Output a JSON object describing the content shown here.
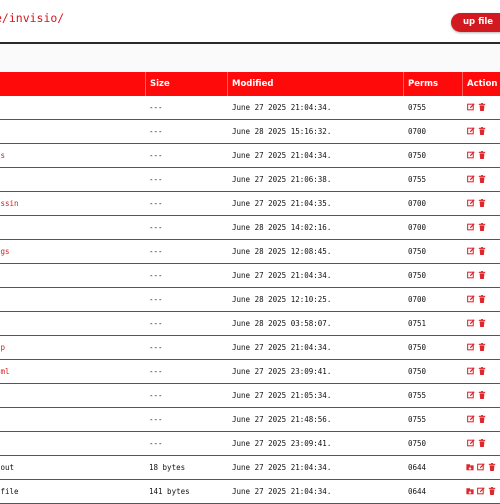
{
  "header": {
    "path": "e/invisio/",
    "upload_label": "up file"
  },
  "columns": [
    {
      "key": "name",
      "label": ""
    },
    {
      "key": "size",
      "label": "Size"
    },
    {
      "key": "modified",
      "label": "Modified"
    },
    {
      "key": "perms",
      "label": "Perms"
    },
    {
      "key": "actions",
      "label": "Action"
    }
  ],
  "rows": [
    {
      "name": "",
      "type": "dir",
      "size": "---",
      "modified": "June 27 2025 21:04:34.",
      "perms": "0755"
    },
    {
      "name": "",
      "type": "dir",
      "size": "---",
      "modified": "June 28 2025 15:16:32.",
      "perms": "0700"
    },
    {
      "name": "ds",
      "type": "dir",
      "size": "---",
      "modified": "June 27 2025 21:04:34.",
      "perms": "0750"
    },
    {
      "name": "",
      "type": "dir",
      "size": "---",
      "modified": "June 27 2025 21:06:38.",
      "perms": "0755"
    },
    {
      "name": "assin",
      "type": "dir",
      "size": "---",
      "modified": "June 27 2025 21:04:35.",
      "perms": "0700"
    },
    {
      "name": "",
      "type": "dir",
      "size": "---",
      "modified": "June 28 2025 14:02:16.",
      "perms": "0700"
    },
    {
      "name": "ogs",
      "type": "dir",
      "size": "---",
      "modified": "June 28 2025 12:08:45.",
      "perms": "0750"
    },
    {
      "name": "",
      "type": "dir",
      "size": "---",
      "modified": "June 27 2025 21:04:34.",
      "perms": "0750"
    },
    {
      "name": "",
      "type": "dir",
      "size": "---",
      "modified": "June 28 2025 12:10:25.",
      "perms": "0700"
    },
    {
      "name": "",
      "type": "dir",
      "size": "---",
      "modified": "June 28 2025 03:58:07.",
      "perms": "0751"
    },
    {
      "name": "tp",
      "type": "dir",
      "size": "---",
      "modified": "June 27 2025 21:04:34.",
      "perms": "0750"
    },
    {
      "name": "tml",
      "type": "dir",
      "size": "---",
      "modified": "June 27 2025 23:09:41.",
      "perms": "0750"
    },
    {
      "name": "",
      "type": "dir",
      "size": "---",
      "modified": "June 27 2025 21:05:34.",
      "perms": "0755"
    },
    {
      "name": "",
      "type": "dir",
      "size": "---",
      "modified": "June 27 2025 21:48:56.",
      "perms": "0755"
    },
    {
      "name": "",
      "type": "dir",
      "size": "---",
      "modified": "June 27 2025 23:09:41.",
      "perms": "0750"
    },
    {
      "name": "gout",
      "type": "file",
      "size": "18 bytes",
      "modified": "June 27 2025 21:04:34.",
      "perms": "0644"
    },
    {
      "name": "efile",
      "type": "file",
      "size": "141 bytes",
      "modified": "June 27 2025 21:04:34.",
      "perms": "0644"
    }
  ],
  "icons": {
    "edit": "edit-icon",
    "delete": "trash-icon",
    "download": "download-icon"
  },
  "colors": {
    "accent": "#d2191f",
    "header_bg": "#ff0a0a",
    "icon": "#e0262b"
  }
}
